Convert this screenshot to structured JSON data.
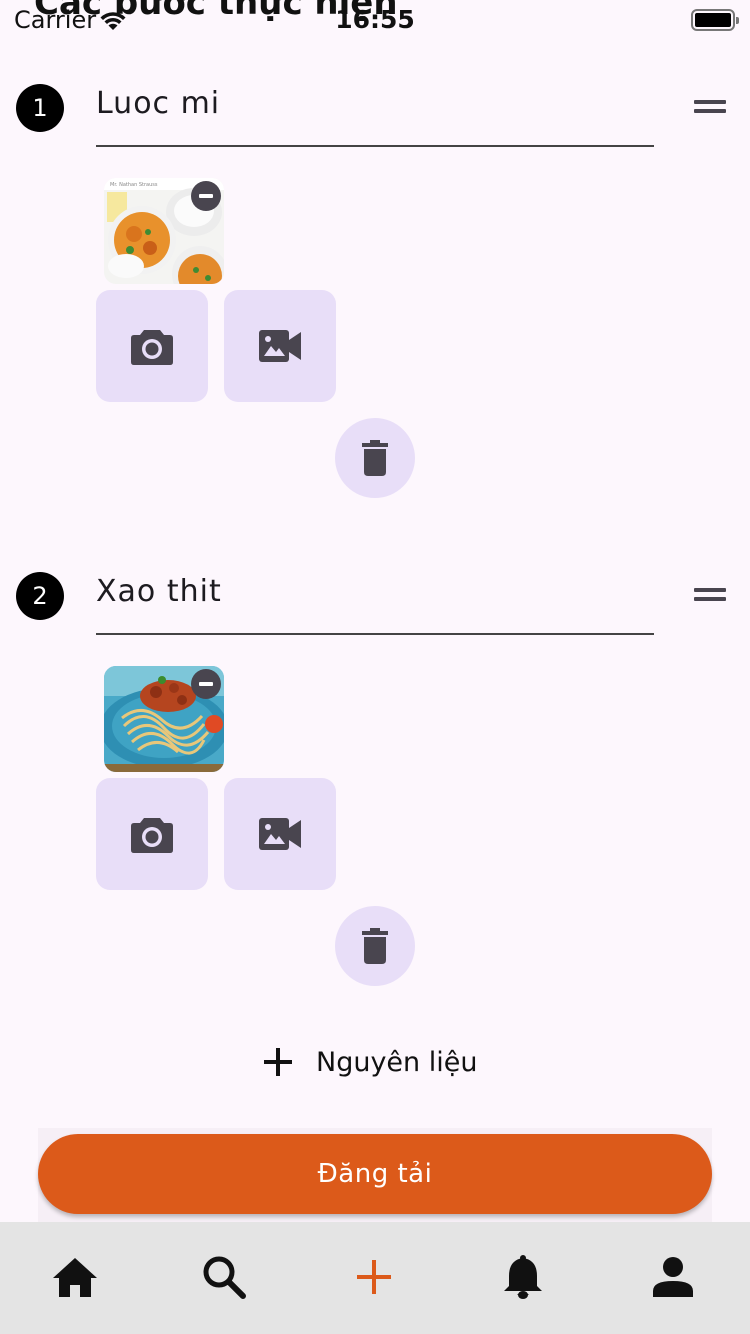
{
  "status_bar": {
    "carrier": "Carrier",
    "time": "16:55"
  },
  "section": {
    "title": "Các bước thực hiện"
  },
  "steps": [
    {
      "number": "1",
      "text": "Luoc mi",
      "image_icon": "curry-dish-photo"
    },
    {
      "number": "2",
      "text": "Xao thit",
      "image_icon": "spaghetti-dish-photo"
    }
  ],
  "actions": {
    "add_ingredient_label": "Nguyên liệu",
    "upload_label": "Đăng tải"
  },
  "nav": {
    "items": [
      "home-icon",
      "search-icon",
      "add-icon",
      "bell-icon",
      "person-icon"
    ],
    "active_index": 2,
    "active_color": "#dc5a1a"
  },
  "colors": {
    "background": "#fdf7fd",
    "primary": "#dc5a1a",
    "tonal_button": "#e8def8",
    "icon": "#49454f"
  }
}
